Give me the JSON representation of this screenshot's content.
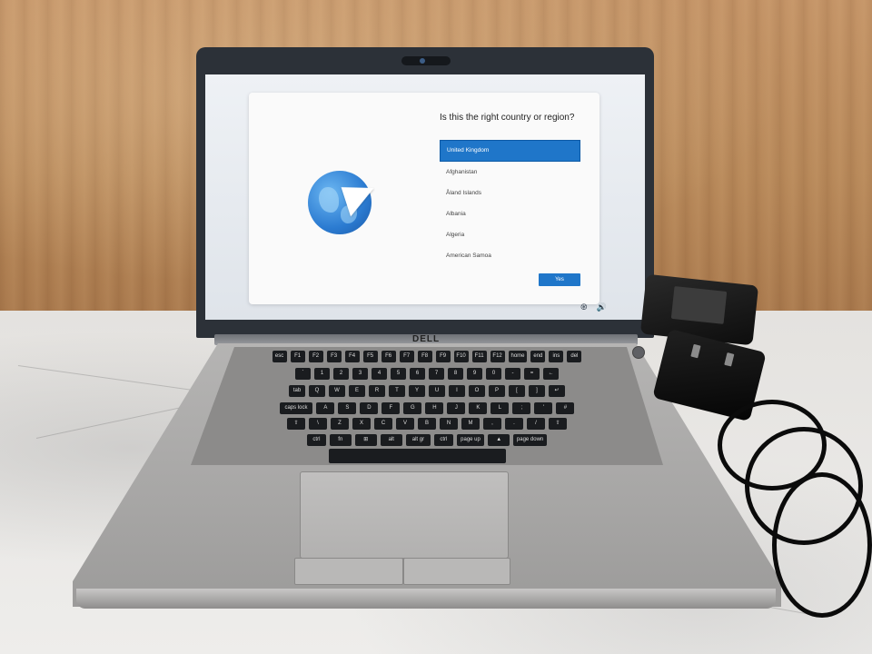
{
  "oobe": {
    "question": "Is this the right country or region?",
    "countries": [
      {
        "label": "United Kingdom",
        "selected": true
      },
      {
        "label": "Afghanistan",
        "selected": false
      },
      {
        "label": "Åland Islands",
        "selected": false
      },
      {
        "label": "Albania",
        "selected": false
      },
      {
        "label": "Algeria",
        "selected": false
      },
      {
        "label": "American Samoa",
        "selected": false
      }
    ],
    "yes_label": "Yes"
  },
  "laptop": {
    "brand_logo": "DELL"
  },
  "keyboard_rows": [
    [
      "esc",
      "F1",
      "F2",
      "F3",
      "F4",
      "F5",
      "F6",
      "F7",
      "F8",
      "F9",
      "F10",
      "F11",
      "F12",
      "home",
      "end",
      "ins",
      "del"
    ],
    [
      "`",
      "1",
      "2",
      "3",
      "4",
      "5",
      "6",
      "7",
      "8",
      "9",
      "0",
      "-",
      "=",
      "←"
    ],
    [
      "tab",
      "Q",
      "W",
      "E",
      "R",
      "T",
      "Y",
      "U",
      "I",
      "O",
      "P",
      "[",
      "]",
      "↵"
    ],
    [
      "caps lock",
      "A",
      "S",
      "D",
      "F",
      "G",
      "H",
      "J",
      "K",
      "L",
      ";",
      "'",
      "#"
    ],
    [
      "⇧",
      "\\",
      "Z",
      "X",
      "C",
      "V",
      "B",
      "N",
      "M",
      ",",
      ".",
      "/",
      "⇧"
    ],
    [
      "ctrl",
      "fn",
      "⊞",
      "alt",
      "alt gr",
      "ctrl",
      "page up",
      "▲",
      "page down"
    ]
  ],
  "icons": {
    "accessibility": "accessibility-icon",
    "volume": "volume-icon",
    "globe": "globe-icon",
    "paper_plane": "paper-plane-icon"
  },
  "colors": {
    "accent": "#1f76c9",
    "wood": "#b98a5c",
    "marble": "#e8e7e5"
  }
}
